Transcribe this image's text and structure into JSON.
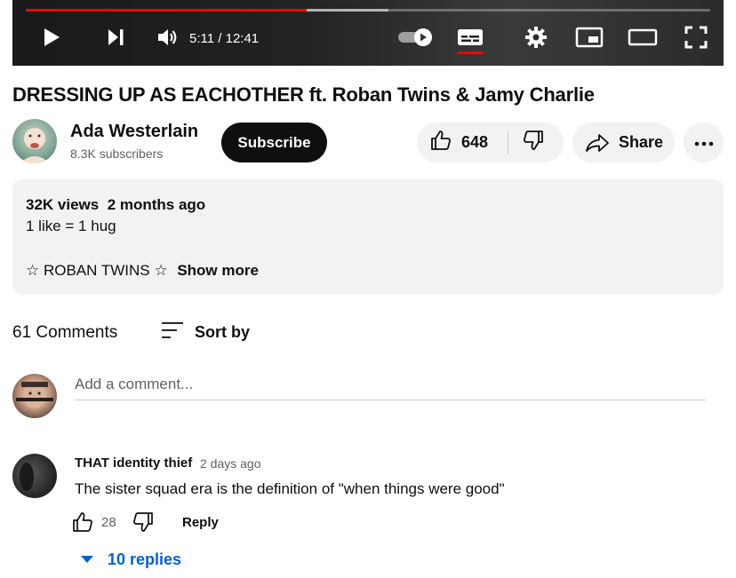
{
  "player": {
    "progress": 0.41,
    "buffered": 0.53,
    "current_time": "5:11",
    "time_sep": " / ",
    "duration": "12:41",
    "captions_on": true,
    "accent_color": "#ff0000"
  },
  "video": {
    "title": "DRESSING UP AS EACHOTHER ft. Roban Twins & Jamy Charlie"
  },
  "channel": {
    "name": "Ada Westerlain",
    "subscribers": "8.3K subscribers",
    "subscribe_label": "Subscribe"
  },
  "actions": {
    "like_count": "648",
    "share_label": "Share"
  },
  "description": {
    "views": "32K views",
    "age": "2 months ago",
    "line1": "1 like = 1 hug",
    "tagline": "☆ ROBAN TWINS ☆",
    "show_more": "Show more"
  },
  "comments": {
    "count_label": "61 Comments",
    "sort_label": "Sort by",
    "add_placeholder": "Add a comment...",
    "items": [
      {
        "author": "THAT identity thief",
        "time": "2 days ago",
        "text": "The sister squad era is the definition of \"when things were good\"",
        "likes": "28",
        "reply_label": "Reply",
        "replies_label": "10 replies"
      }
    ]
  }
}
